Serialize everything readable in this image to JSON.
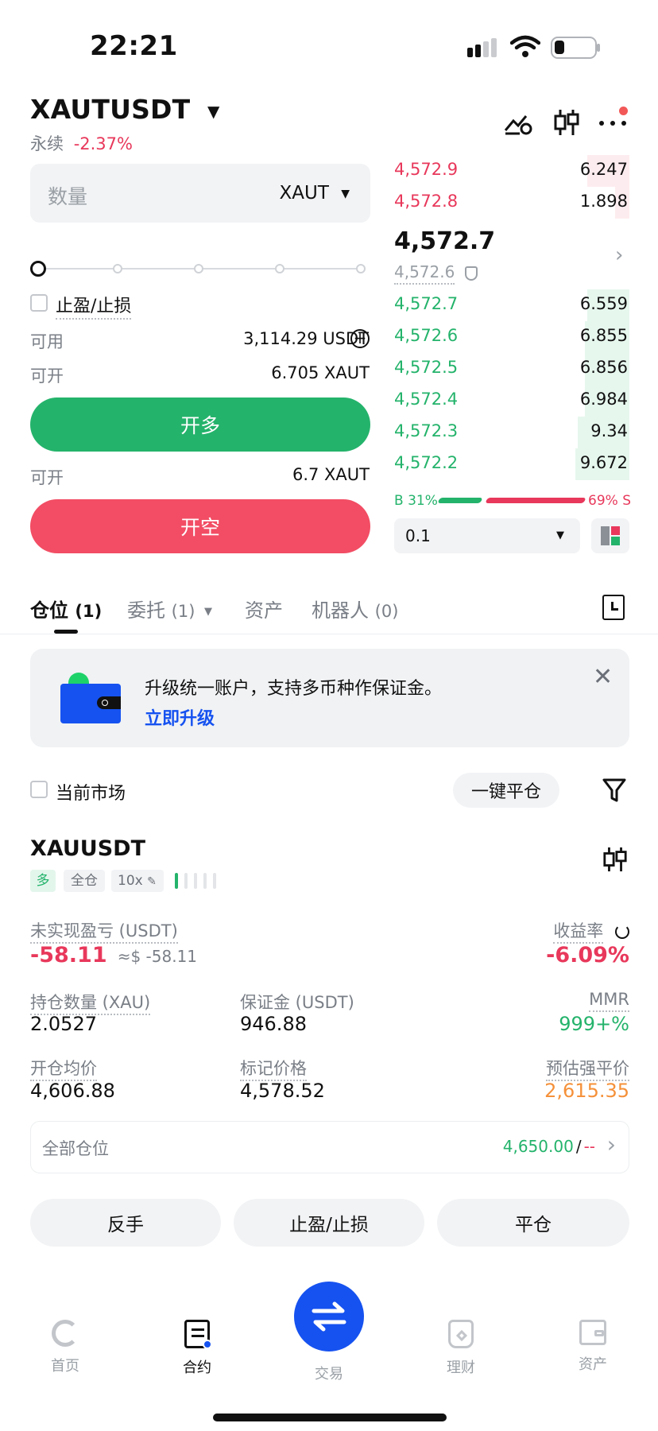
{
  "status_bar": {
    "time": "22:21"
  },
  "header": {
    "symbol": "XAUTUSDT",
    "type_label": "永续",
    "change": "-2.37%"
  },
  "order_form": {
    "qty_placeholder": "数量",
    "qty_unit": "XAUT",
    "tp_sl_label": "止盈/止损",
    "available_label": "可用",
    "available_value": "3,114.29 USDT",
    "open_long_label": "可开",
    "open_long_value": "6.705 XAUT",
    "long_button": "开多",
    "open_short_label": "可开",
    "open_short_value": "6.7 XAUT",
    "short_button": "开空"
  },
  "order_book": {
    "asks": [
      {
        "price": "4,572.9",
        "qty": "6.247",
        "depth": 0.18
      },
      {
        "price": "4,572.8",
        "qty": "1.898",
        "depth": 0.06
      }
    ],
    "last_price": "4,572.7",
    "mark_price": "4,572.6",
    "bids": [
      {
        "price": "4,572.7",
        "qty": "6.559",
        "depth": 0.18
      },
      {
        "price": "4,572.6",
        "qty": "6.855",
        "depth": 0.19
      },
      {
        "price": "4,572.5",
        "qty": "6.856",
        "depth": 0.19
      },
      {
        "price": "4,572.4",
        "qty": "6.984",
        "depth": 0.19
      },
      {
        "price": "4,572.3",
        "qty": "9.34",
        "depth": 0.22
      },
      {
        "price": "4,572.2",
        "qty": "9.672",
        "depth": 0.23
      }
    ],
    "ratio_buy": "B 31%",
    "ratio_sell": "69% S",
    "buy_fraction": 0.31,
    "precision": "0.1"
  },
  "tabs": {
    "positions": "仓位",
    "positions_count": "(1)",
    "orders": "委托",
    "orders_count": "(1)",
    "assets": "资产",
    "bots": "机器人",
    "bots_count": "(0)"
  },
  "banner": {
    "text": "升级统一账户，支持多币种作保证金。",
    "link": "立即升级"
  },
  "filter": {
    "current_market": "当前市场",
    "close_all": "一键平仓"
  },
  "position": {
    "symbol": "XAUUSDT",
    "side": "多",
    "margin_mode": "全仓",
    "leverage": "10x",
    "upnl_label": "未实现盈亏 (USDT)",
    "upnl_value": "-58.11",
    "upnl_usd": "≈$ -58.11",
    "roi_label": "收益率",
    "roi_value": "-6.09%",
    "size_label": "持仓数量 (XAU)",
    "size_value": "2.0527",
    "margin_label": "保证金 (USDT)",
    "margin_value": "946.88",
    "mmr_label": "MMR",
    "mmr_value": "999+%",
    "entry_label": "开仓均价",
    "entry_value": "4,606.88",
    "mark_label": "标记价格",
    "mark_value": "4,578.52",
    "liq_label": "预估强平价",
    "liq_value": "2,615.35",
    "tpsl_all_label": "全部仓位",
    "tpsl_tp": "4,650.00",
    "tpsl_sep": "/",
    "tpsl_sl": "--",
    "btn_reverse": "反手",
    "btn_tpsl": "止盈/止损",
    "btn_close": "平仓"
  },
  "bottom_nav": {
    "home": "首页",
    "contract": "合约",
    "trade": "交易",
    "finance": "理财",
    "assets": "资产"
  },
  "colors": {
    "green": "#24b36b",
    "red": "#e8385b",
    "blue": "#1652f0",
    "orange": "#f5913a"
  }
}
